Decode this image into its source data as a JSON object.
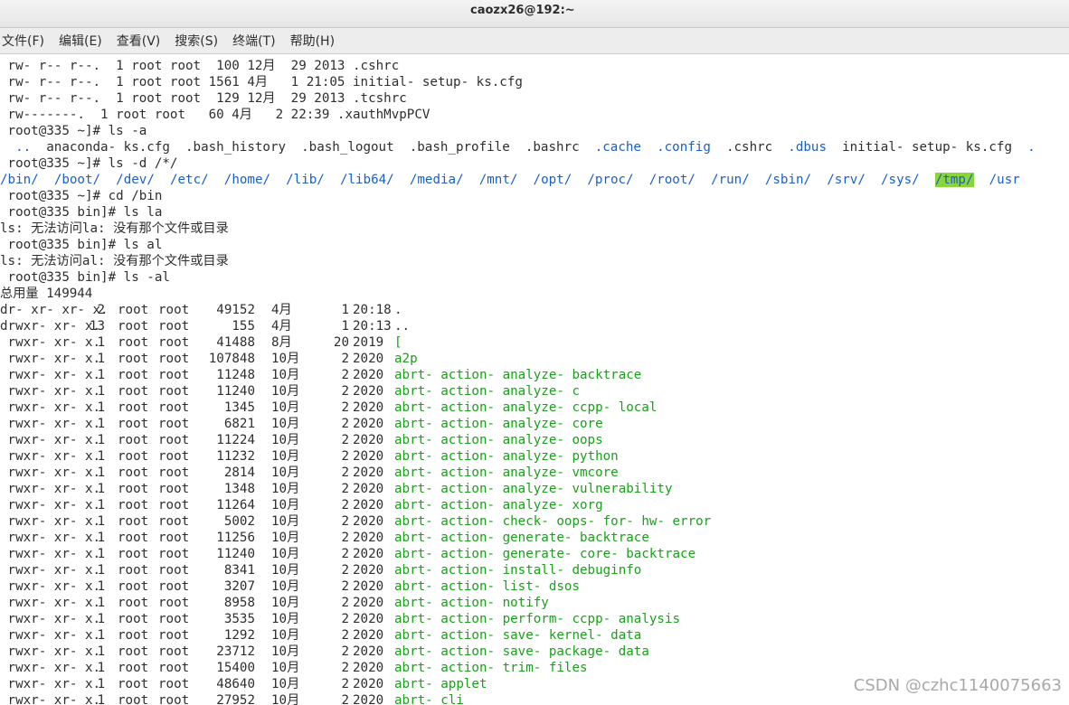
{
  "window": {
    "title": "caozx26@192:~"
  },
  "menu": [
    "文件(F)",
    "编辑(E)",
    "查看(V)",
    "搜索(S)",
    "终端(T)",
    "帮助(H)"
  ],
  "top_lines": [
    " rw- r-- r--.  1 root root  100 12月  29 2013 .cshrc",
    " rw- r-- r--.  1 root root 1561 4月   1 21:05 initial- setup- ks.cfg",
    " rw- r-- r--.  1 root root  129 12月  29 2013 .tcshrc",
    " rw-------.  1 root root   60 4月   2 22:39 .xauthMvpPCV",
    " root@335 ~]# ls -a"
  ],
  "ls_a": [
    {
      "text": "  ..",
      "color": "blue"
    },
    {
      "text": "  anaconda- ks.cfg",
      "color": "plain"
    },
    {
      "text": "  .bash_history",
      "color": "plain"
    },
    {
      "text": "  .bash_logout",
      "color": "plain"
    },
    {
      "text": "  .bash_profile",
      "color": "plain"
    },
    {
      "text": "  .bashrc",
      "color": "plain"
    },
    {
      "text": "  .cache",
      "color": "blue"
    },
    {
      "text": "  .config",
      "color": "blue"
    },
    {
      "text": "  .cshrc",
      "color": "plain"
    },
    {
      "text": "  .dbus",
      "color": "blue"
    },
    {
      "text": "  initial- setup- ks.cfg",
      "color": "plain"
    },
    {
      "text": "  .",
      "color": "blue"
    }
  ],
  "prompt_lsd": " root@335 ~]# ls -d /*/",
  "ls_d": [
    {
      "text": "/bin/",
      "hl": false
    },
    {
      "text": "/boot/",
      "hl": false
    },
    {
      "text": "/dev/",
      "hl": false
    },
    {
      "text": "/etc/",
      "hl": false
    },
    {
      "text": "/home/",
      "hl": false
    },
    {
      "text": "/lib/",
      "hl": false
    },
    {
      "text": "/lib64/",
      "hl": false
    },
    {
      "text": "/media/",
      "hl": false
    },
    {
      "text": "/mnt/",
      "hl": false
    },
    {
      "text": "/opt/",
      "hl": false
    },
    {
      "text": "/proc/",
      "hl": false
    },
    {
      "text": "/root/",
      "hl": false
    },
    {
      "text": "/run/",
      "hl": false
    },
    {
      "text": "/sbin/",
      "hl": false
    },
    {
      "text": "/srv/",
      "hl": false
    },
    {
      "text": "/sys/",
      "hl": false
    },
    {
      "text": "/tmp/",
      "hl": true
    },
    {
      "text": "/usr",
      "hl": false
    }
  ],
  "mid_lines": [
    " root@335 ~]# cd /bin",
    " root@335 bin]# ls la",
    "ls: 无法访问la: 没有那个文件或目录",
    " root@335 bin]# ls al",
    "ls: 无法访问al: 没有那个文件或目录",
    " root@335 bin]# ls -al",
    "总用量 149944"
  ],
  "listing": [
    {
      "perm": "dr- xr- xr- x.",
      "links": "2",
      "owner": "root",
      "group": "root",
      "size": "49152",
      "month": "4月",
      "day": "1",
      "time": "20:18",
      "name": ".",
      "color": "blue"
    },
    {
      "perm": "drwxr- xr- x.",
      "links": "13",
      "owner": "root",
      "group": "root",
      "size": "155",
      "month": "4月",
      "day": "1",
      "time": "20:13",
      "name": "..",
      "color": "blue"
    },
    {
      "perm": " rwxr- xr- x.",
      "links": "1",
      "owner": "root",
      "group": "root",
      "size": "41488",
      "month": "8月",
      "day": "20",
      "time": "2019",
      "name": "[",
      "color": "green"
    },
    {
      "perm": " rwxr- xr- x.",
      "links": "1",
      "owner": "root",
      "group": "root",
      "size": "107848",
      "month": "10月",
      "day": "2",
      "time": "2020",
      "name": "a2p",
      "color": "green"
    },
    {
      "perm": " rwxr- xr- x.",
      "links": "1",
      "owner": "root",
      "group": "root",
      "size": "11248",
      "month": "10月",
      "day": "2",
      "time": "2020",
      "name": "abrt- action- analyze- backtrace",
      "color": "green"
    },
    {
      "perm": " rwxr- xr- x.",
      "links": "1",
      "owner": "root",
      "group": "root",
      "size": "11240",
      "month": "10月",
      "day": "2",
      "time": "2020",
      "name": "abrt- action- analyze- c",
      "color": "green"
    },
    {
      "perm": " rwxr- xr- x.",
      "links": "1",
      "owner": "root",
      "group": "root",
      "size": "1345",
      "month": "10月",
      "day": "2",
      "time": "2020",
      "name": "abrt- action- analyze- ccpp- local",
      "color": "green"
    },
    {
      "perm": " rwxr- xr- x.",
      "links": "1",
      "owner": "root",
      "group": "root",
      "size": "6821",
      "month": "10月",
      "day": "2",
      "time": "2020",
      "name": "abrt- action- analyze- core",
      "color": "green"
    },
    {
      "perm": " rwxr- xr- x.",
      "links": "1",
      "owner": "root",
      "group": "root",
      "size": "11224",
      "month": "10月",
      "day": "2",
      "time": "2020",
      "name": "abrt- action- analyze- oops",
      "color": "green"
    },
    {
      "perm": " rwxr- xr- x.",
      "links": "1",
      "owner": "root",
      "group": "root",
      "size": "11232",
      "month": "10月",
      "day": "2",
      "time": "2020",
      "name": "abrt- action- analyze- python",
      "color": "green"
    },
    {
      "perm": " rwxr- xr- x.",
      "links": "1",
      "owner": "root",
      "group": "root",
      "size": "2814",
      "month": "10月",
      "day": "2",
      "time": "2020",
      "name": "abrt- action- analyze- vmcore",
      "color": "green"
    },
    {
      "perm": " rwxr- xr- x.",
      "links": "1",
      "owner": "root",
      "group": "root",
      "size": "1348",
      "month": "10月",
      "day": "2",
      "time": "2020",
      "name": "abrt- action- analyze- vulnerability",
      "color": "green"
    },
    {
      "perm": " rwxr- xr- x.",
      "links": "1",
      "owner": "root",
      "group": "root",
      "size": "11264",
      "month": "10月",
      "day": "2",
      "time": "2020",
      "name": "abrt- action- analyze- xorg",
      "color": "green"
    },
    {
      "perm": " rwxr- xr- x.",
      "links": "1",
      "owner": "root",
      "group": "root",
      "size": "5002",
      "month": "10月",
      "day": "2",
      "time": "2020",
      "name": "abrt- action- check- oops- for- hw- error",
      "color": "green"
    },
    {
      "perm": " rwxr- xr- x.",
      "links": "1",
      "owner": "root",
      "group": "root",
      "size": "11256",
      "month": "10月",
      "day": "2",
      "time": "2020",
      "name": "abrt- action- generate- backtrace",
      "color": "green"
    },
    {
      "perm": " rwxr- xr- x.",
      "links": "1",
      "owner": "root",
      "group": "root",
      "size": "11240",
      "month": "10月",
      "day": "2",
      "time": "2020",
      "name": "abrt- action- generate- core- backtrace",
      "color": "green"
    },
    {
      "perm": " rwxr- xr- x.",
      "links": "1",
      "owner": "root",
      "group": "root",
      "size": "8341",
      "month": "10月",
      "day": "2",
      "time": "2020",
      "name": "abrt- action- install- debuginfo",
      "color": "green"
    },
    {
      "perm": " rwxr- xr- x.",
      "links": "1",
      "owner": "root",
      "group": "root",
      "size": "3207",
      "month": "10月",
      "day": "2",
      "time": "2020",
      "name": "abrt- action- list- dsos",
      "color": "green"
    },
    {
      "perm": " rwxr- xr- x.",
      "links": "1",
      "owner": "root",
      "group": "root",
      "size": "8958",
      "month": "10月",
      "day": "2",
      "time": "2020",
      "name": "abrt- action- notify",
      "color": "green"
    },
    {
      "perm": " rwxr- xr- x.",
      "links": "1",
      "owner": "root",
      "group": "root",
      "size": "3535",
      "month": "10月",
      "day": "2",
      "time": "2020",
      "name": "abrt- action- perform- ccpp- analysis",
      "color": "green"
    },
    {
      "perm": " rwxr- xr- x.",
      "links": "1",
      "owner": "root",
      "group": "root",
      "size": "1292",
      "month": "10月",
      "day": "2",
      "time": "2020",
      "name": "abrt- action- save- kernel- data",
      "color": "green"
    },
    {
      "perm": " rwxr- xr- x.",
      "links": "1",
      "owner": "root",
      "group": "root",
      "size": "23712",
      "month": "10月",
      "day": "2",
      "time": "2020",
      "name": "abrt- action- save- package- data",
      "color": "green"
    },
    {
      "perm": " rwxr- xr- x.",
      "links": "1",
      "owner": "root",
      "group": "root",
      "size": "15400",
      "month": "10月",
      "day": "2",
      "time": "2020",
      "name": "abrt- action- trim- files",
      "color": "green"
    },
    {
      "perm": " rwxr- xr- x.",
      "links": "1",
      "owner": "root",
      "group": "root",
      "size": "48640",
      "month": "10月",
      "day": "2",
      "time": "2020",
      "name": "abrt- applet",
      "color": "green"
    },
    {
      "perm": " rwxr- xr- x.",
      "links": "1",
      "owner": "root",
      "group": "root",
      "size": "27952",
      "month": "10月",
      "day": "2",
      "time": "2020",
      "name": "abrt- cli",
      "color": "green"
    }
  ],
  "watermark": "CSDN @czhc1140075663"
}
